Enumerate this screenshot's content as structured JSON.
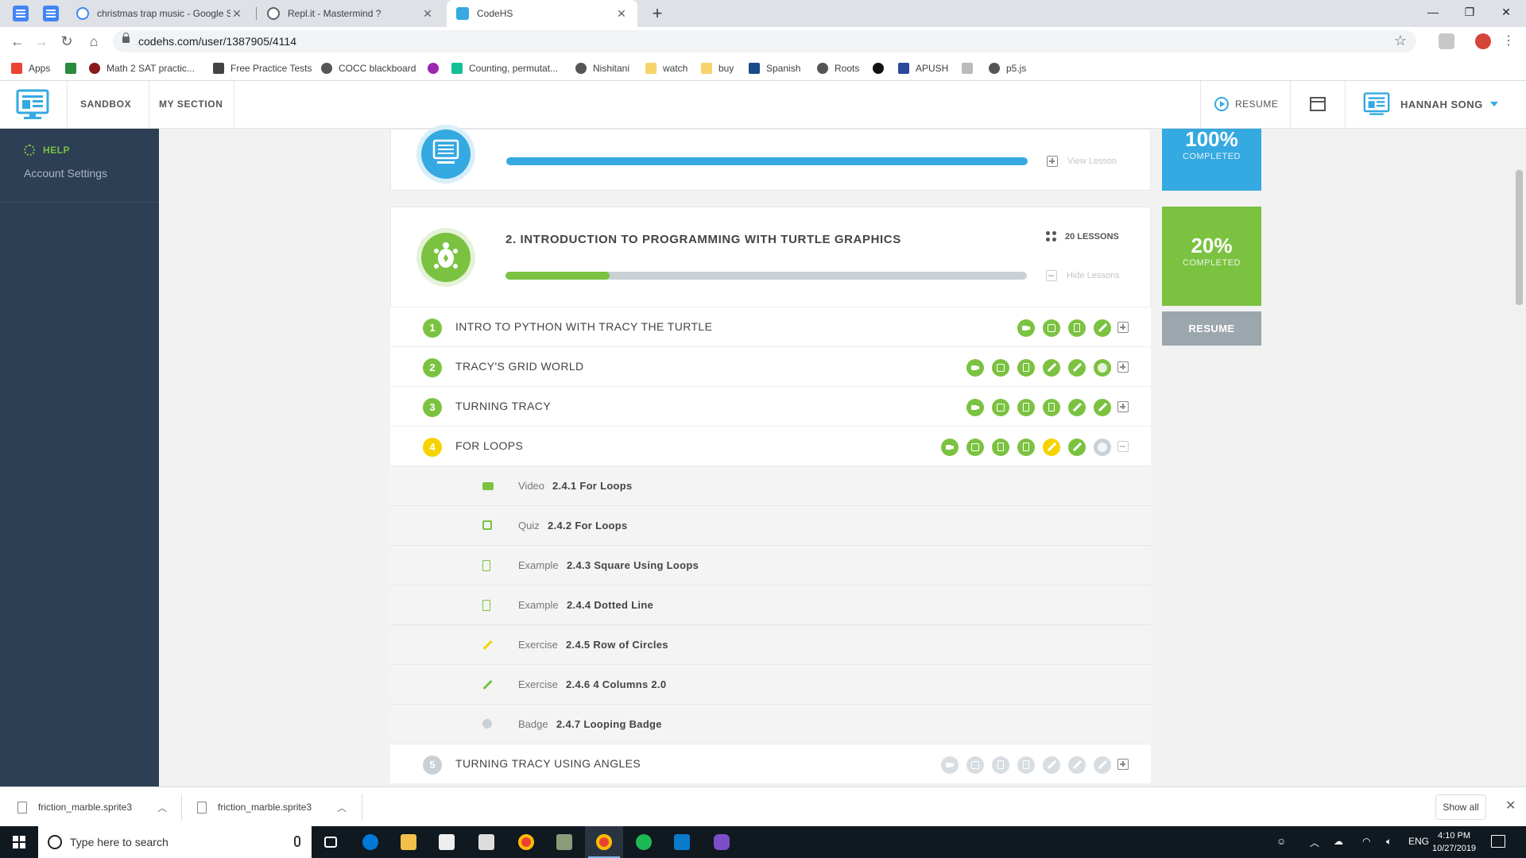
{
  "browser": {
    "tabs": [
      {
        "title": "christmas trap music - Google Se",
        "active": false
      },
      {
        "title": "Repl.it - Mastermind ?",
        "active": false
      },
      {
        "title": "CodeHS",
        "active": true
      }
    ],
    "url": "codehs.com/user/1387905/4114",
    "bookmarks": [
      "Apps",
      "Math 2 SAT practic...",
      "Free Practice Tests",
      "COCC blackboard",
      "Counting, permutat...",
      "Nishitani",
      "watch",
      "buy",
      "Spanish",
      "Roots",
      "APUSH",
      "p5.js"
    ]
  },
  "header": {
    "nav": [
      "SANDBOX",
      "MY SECTION"
    ],
    "resume_label": "RESUME",
    "user_name": "HANNAH SONG"
  },
  "sidebar": {
    "help_label": "HELP",
    "account_settings": "Account Settings"
  },
  "unit1": {
    "progress": 1.0,
    "view_label": "View Lesson",
    "percent": "100%",
    "completed_label": "COMPLETED"
  },
  "unit2": {
    "title": "2. INTRODUCTION TO PROGRAMMING WITH TURTLE GRAPHICS",
    "lessons_count": "20 LESSONS",
    "hide_label": "Hide Lessons",
    "progress": 0.2,
    "percent": "20%",
    "completed_label": "COMPLETED",
    "resume_label": "RESUME",
    "lessons": [
      {
        "num": "1",
        "title": "INTRO TO PYTHON WITH TRACY THE TURTLE",
        "status": "done",
        "activities": [
          "video",
          "quiz",
          "example",
          "exercise"
        ]
      },
      {
        "num": "2",
        "title": "TRACY'S GRID WORLD",
        "status": "done",
        "activities": [
          "video",
          "quiz",
          "example",
          "exercise",
          "exercise",
          "badge"
        ]
      },
      {
        "num": "3",
        "title": "TURNING TRACY",
        "status": "done",
        "activities": [
          "video",
          "quiz",
          "example",
          "example",
          "exercise",
          "exercise"
        ]
      },
      {
        "num": "4",
        "title": "FOR LOOPS",
        "status": "current",
        "activities": [
          "video",
          "quiz",
          "example",
          "example",
          "exercise",
          "exercise",
          "badge"
        ]
      },
      {
        "num": "5",
        "title": "TURNING TRACY USING ANGLES",
        "status": "locked",
        "activities": [
          "video",
          "quiz",
          "example",
          "example",
          "exercise",
          "exercise",
          "exercise"
        ]
      }
    ],
    "expanded_items": [
      {
        "type": "Video",
        "name": "2.4.1 For Loops",
        "icon": "video-icon"
      },
      {
        "type": "Quiz",
        "name": "2.4.2 For Loops",
        "icon": "quiz-check-icon"
      },
      {
        "type": "Example",
        "name": "2.4.3 Square Using Loops",
        "icon": "document-icon"
      },
      {
        "type": "Example",
        "name": "2.4.4 Dotted Line",
        "icon": "document-icon"
      },
      {
        "type": "Exercise",
        "name": "2.4.5 Row of Circles",
        "icon": "pencil-icon"
      },
      {
        "type": "Exercise",
        "name": "2.4.6 4 Columns 2.0",
        "icon": "pencil-icon"
      },
      {
        "type": "Badge",
        "name": "2.4.7 Looping Badge",
        "icon": "badge-icon"
      }
    ]
  },
  "downloads": {
    "files": [
      "friction_marble.sprite3",
      "friction_marble.sprite3"
    ],
    "show_all": "Show all"
  },
  "taskbar": {
    "search_placeholder": "Type here to search",
    "language": "ENG",
    "time": "4:10 PM",
    "date": "10/27/2019"
  },
  "colors": {
    "green": "#7bc241",
    "blue": "#35a9e1",
    "yellow": "#f5d300",
    "gray": "#c9d1d6",
    "sidebar": "#2c3f54"
  }
}
